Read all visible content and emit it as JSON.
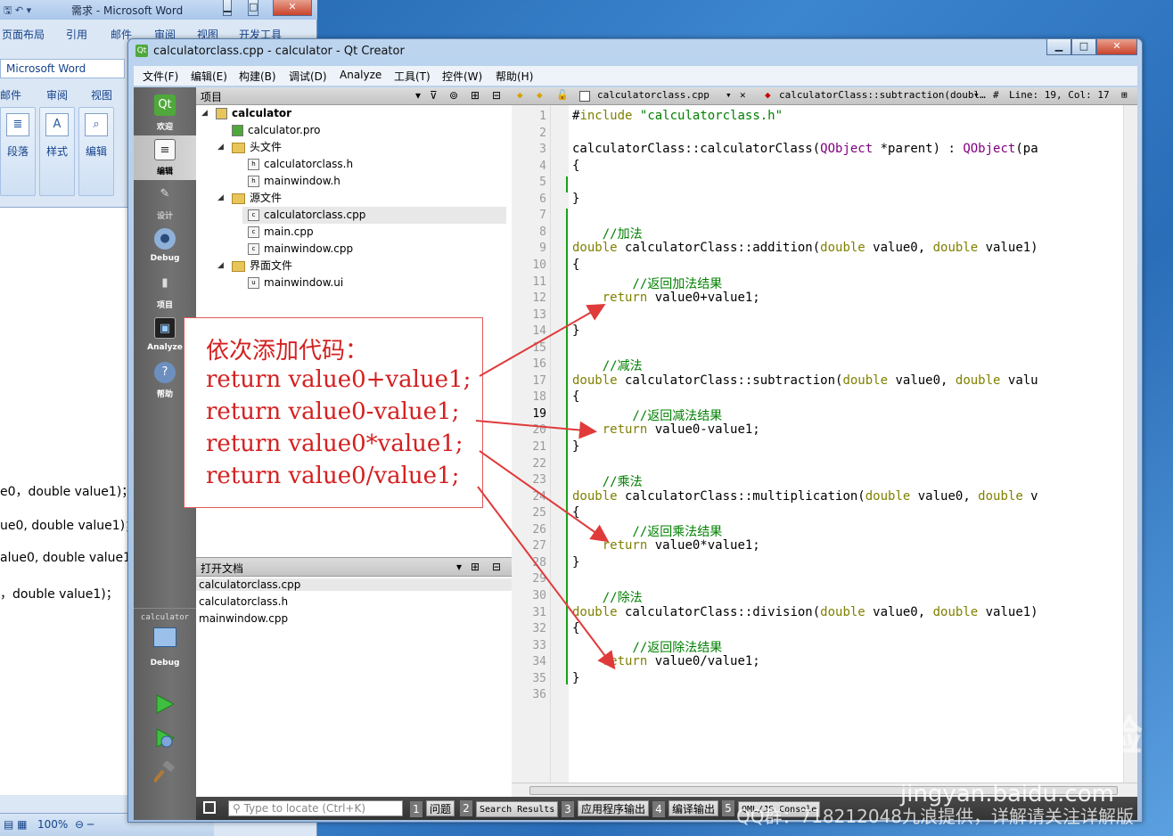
{
  "word": {
    "title": "需求 - Microsoft Word",
    "tabs": [
      "页面布局",
      "引用",
      "邮件",
      "审阅",
      "视图",
      "开发工具"
    ],
    "tabs2": [
      "邮件",
      "审阅",
      "视图"
    ],
    "app_label": "Microsoft Word",
    "groups": [
      "段落",
      "样式",
      "编辑"
    ],
    "doc_lines": [
      "e0，double value1)；",
      "ue0, double value1)；",
      "alue0, double value1)",
      "，double value1)；"
    ],
    "zoom": "100%"
  },
  "qt": {
    "title": "calculatorclass.cpp - calculator - Qt Creator",
    "menu": [
      "文件(F)",
      "编辑(E)",
      "构建(B)",
      "调试(D)",
      "Analyze",
      "工具(T)",
      "控件(W)",
      "帮助(H)"
    ],
    "modes": [
      {
        "label": "欢迎",
        "icon": "Qt"
      },
      {
        "label": "编辑",
        "icon": "≡"
      },
      {
        "label": "设计",
        "icon": "✎"
      },
      {
        "label": "Debug",
        "icon": "●"
      },
      {
        "label": "项目",
        "icon": "▮"
      },
      {
        "label": "Analyze",
        "icon": "▣"
      },
      {
        "label": "帮助",
        "icon": "?"
      }
    ],
    "kit": {
      "project": "calculator",
      "config": "Debug"
    },
    "project_header": "项目",
    "tree": {
      "root": "calculator",
      "pro": "calculator.pro",
      "headers": "头文件",
      "h1": "calculatorclass.h",
      "h2": "mainwindow.h",
      "sources": "源文件",
      "s1": "calculatorclass.cpp",
      "s2": "main.cpp",
      "s3": "mainwindow.cpp",
      "forms": "界面文件",
      "f1": "mainwindow.ui"
    },
    "open_docs_header": "打开文档",
    "open_docs": [
      "calculatorclass.cpp",
      "calculatorclass.h",
      "mainwindow.cpp"
    ],
    "editor": {
      "file": "calculatorclass.cpp",
      "symbol": "calculatorClass::subtraction(doubl…",
      "position": "Line: 19, Col: 17",
      "current_line": 19
    },
    "status": {
      "locate_placeholder": "Type to locate (Ctrl+K)",
      "tabs": [
        {
          "n": "1",
          "label": "问题"
        },
        {
          "n": "2",
          "label": "Search Results"
        },
        {
          "n": "3",
          "label": "应用程序输出"
        },
        {
          "n": "4",
          "label": "编译输出"
        },
        {
          "n": "5",
          "label": "QML/JS Console"
        }
      ]
    }
  },
  "code_lines": [
    "#include \"calculatorclass.h\"",
    "",
    "calculatorClass::calculatorClass(QObject *parent) : QObject(pa",
    "{",
    "",
    "}",
    "",
    "    //加法",
    "double calculatorClass::addition(double value0, double value1)",
    "{",
    "        //返回加法结果",
    "    return value0+value1;",
    "",
    "}",
    "",
    "    //减法",
    "double calculatorClass::subtraction(double value0, double valu",
    "{",
    "        //返回减法结果",
    "    return value0-value1;",
    "}",
    "",
    "    //乘法",
    "double calculatorClass::multiplication(double value0, double v",
    "{",
    "        //返回乘法结果",
    "    return value0*value1;",
    "}",
    "",
    "    //除法",
    "double calculatorClass::division(double value0, double value1)",
    "{",
    "        //返回除法结果",
    "    return value0/value1;",
    "}",
    ""
  ],
  "annotation": {
    "title": "依次添加代码：",
    "lines": [
      "return value0+value1;",
      "return value0-value1;",
      "return value0*value1;",
      "return value0/value1;"
    ]
  },
  "watermark": {
    "brand": "Bai du 经验",
    "site": "jingyan.baidu.com",
    "credit": "QQ群：718212048九浪提供，详解请关注详解版"
  },
  "colors": {
    "keyword": "#808000",
    "class": "#800080",
    "string": "#008000",
    "comment": "#008000",
    "annotation": "#d42020"
  }
}
